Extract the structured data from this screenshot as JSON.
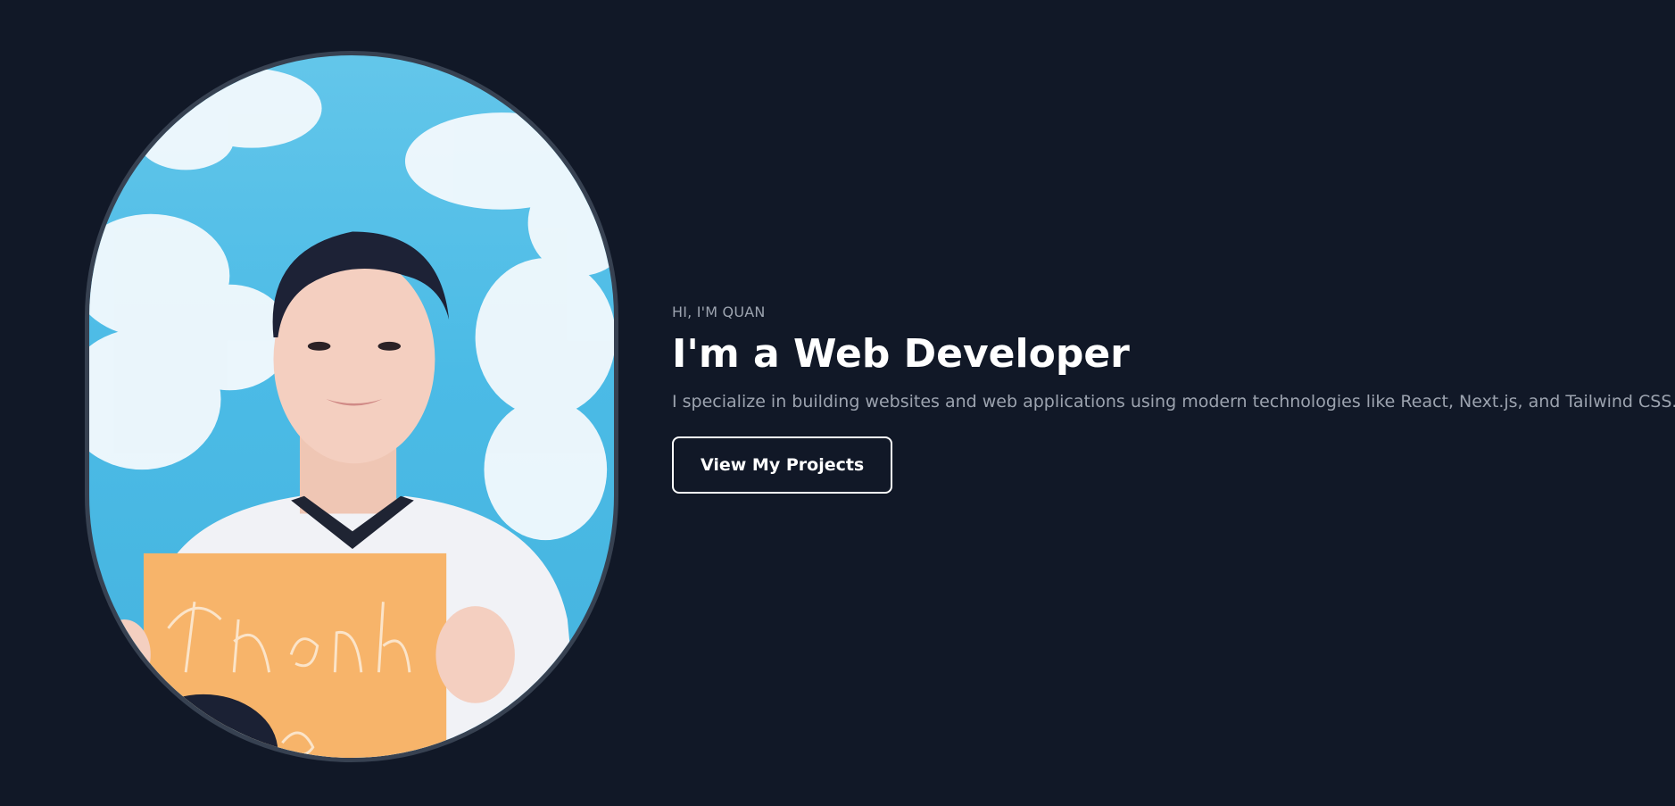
{
  "hero": {
    "greeting": "HI, I'M QUAN",
    "headline": "I'm a Web Developer",
    "description": "I specialize in building websites and web applications using modern technologies like React, Next.js, and Tailwind CSS.",
    "cta_label": "View My Projects"
  },
  "portrait": {
    "sign_text_line1": "Thành",
    "sign_text_line2": "ng"
  },
  "colors": {
    "background": "#111827",
    "frame_border": "#374151",
    "muted_text": "#9ca3af",
    "heading_text": "#ffffff",
    "sky_blue": "#4bbbe6",
    "sign_orange": "#f7b46a"
  }
}
